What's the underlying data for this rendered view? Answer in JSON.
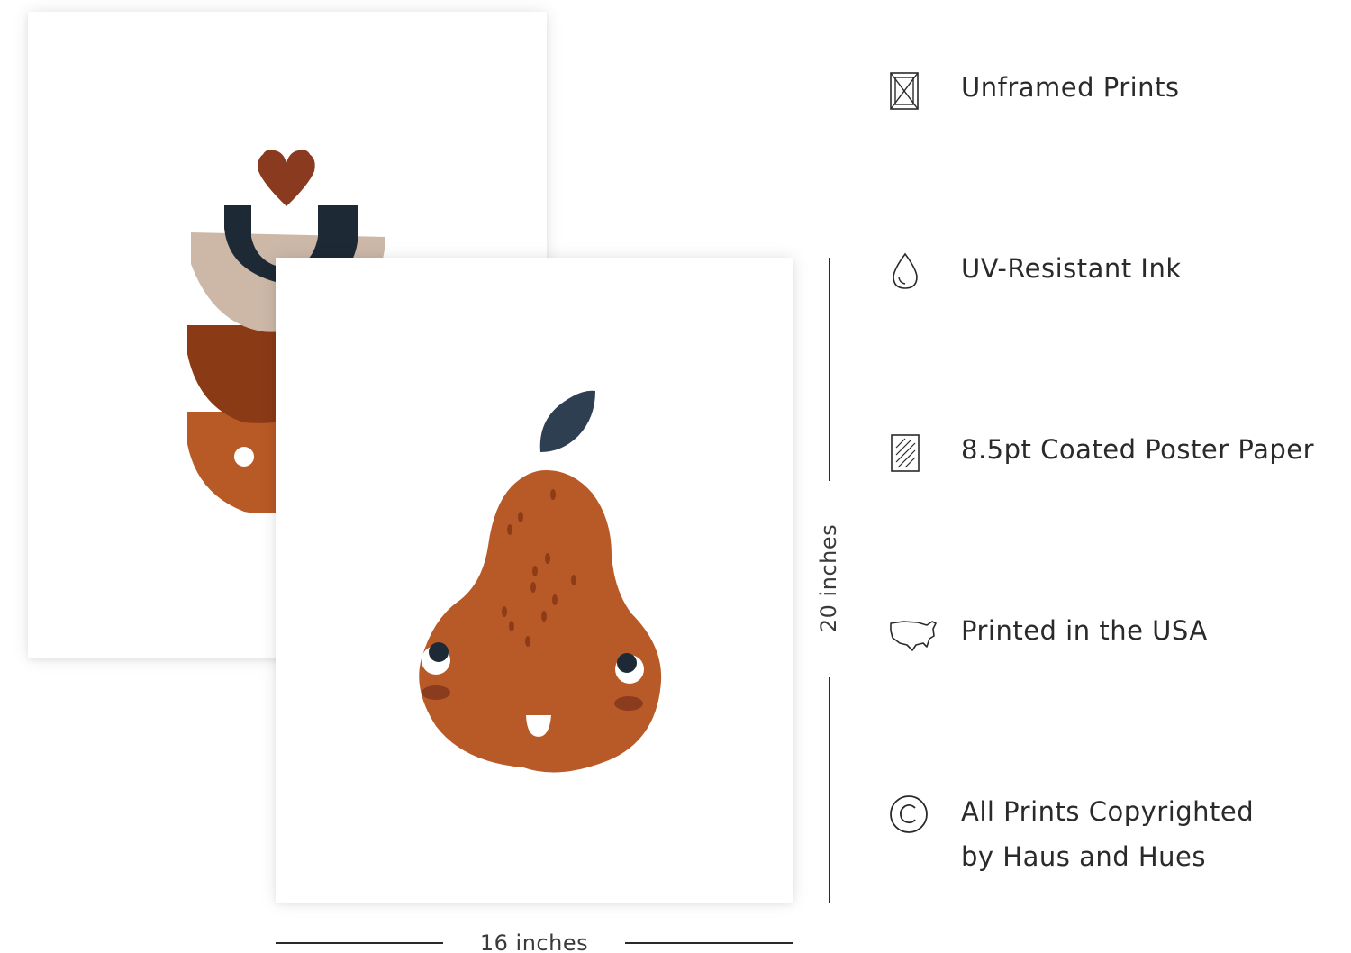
{
  "colors": {
    "heart": "#8a3a1e",
    "navy": "#1d2a36",
    "beige": "#cdb8a8",
    "rust_dark": "#8b3a16",
    "rust": "#b85a26",
    "pear": "#b85a28",
    "pear_spots": "#8e3c17",
    "leaf": "#2f3f52",
    "cheek": "#8c3c1e",
    "line": "#2a2a2a"
  },
  "dimensions": {
    "height_label": "20 inches",
    "width_label": "16 inches"
  },
  "features": [
    {
      "icon": "unframed-icon",
      "label": "Unframed Prints"
    },
    {
      "icon": "ink-drop-icon",
      "label": "UV-Resistant Ink"
    },
    {
      "icon": "paper-icon",
      "label": "8.5pt Coated Poster Paper"
    },
    {
      "icon": "usa-map-icon",
      "label": "Printed in the USA"
    },
    {
      "icon": "copyright-icon",
      "label": "All Prints Copyrighted\nby Haus and Hues"
    }
  ]
}
